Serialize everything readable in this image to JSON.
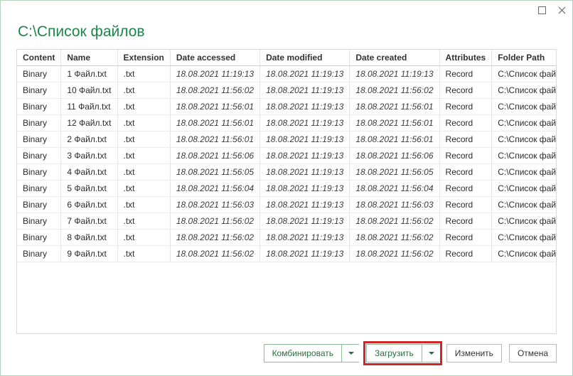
{
  "heading": "C:\\Список файлов",
  "titlebar": {
    "maximize_name": "maximize-icon",
    "close_name": "close-icon"
  },
  "table": {
    "headers": {
      "content": "Content",
      "name": "Name",
      "extension": "Extension",
      "accessed": "Date accessed",
      "modified": "Date modified",
      "created": "Date created",
      "attributes": "Attributes",
      "path": "Folder Path"
    },
    "rows": [
      {
        "content": "Binary",
        "name": "1 Файл.txt",
        "extension": ".txt",
        "accessed": "18.08.2021 11:19:13",
        "modified": "18.08.2021 11:19:13",
        "created": "18.08.2021 11:19:13",
        "attributes": "Record",
        "path": "C:\\Список файлов\\"
      },
      {
        "content": "Binary",
        "name": "10 Файл.txt",
        "extension": ".txt",
        "accessed": "18.08.2021 11:56:02",
        "modified": "18.08.2021 11:19:13",
        "created": "18.08.2021 11:56:02",
        "attributes": "Record",
        "path": "C:\\Список файлов\\"
      },
      {
        "content": "Binary",
        "name": "11 Файл.txt",
        "extension": ".txt",
        "accessed": "18.08.2021 11:56:01",
        "modified": "18.08.2021 11:19:13",
        "created": "18.08.2021 11:56:01",
        "attributes": "Record",
        "path": "C:\\Список файлов\\"
      },
      {
        "content": "Binary",
        "name": "12 Файл.txt",
        "extension": ".txt",
        "accessed": "18.08.2021 11:56:01",
        "modified": "18.08.2021 11:19:13",
        "created": "18.08.2021 11:56:01",
        "attributes": "Record",
        "path": "C:\\Список файлов\\"
      },
      {
        "content": "Binary",
        "name": "2 Файл.txt",
        "extension": ".txt",
        "accessed": "18.08.2021 11:56:01",
        "modified": "18.08.2021 11:19:13",
        "created": "18.08.2021 11:56:01",
        "attributes": "Record",
        "path": "C:\\Список файлов\\"
      },
      {
        "content": "Binary",
        "name": "3 Файл.txt",
        "extension": ".txt",
        "accessed": "18.08.2021 11:56:06",
        "modified": "18.08.2021 11:19:13",
        "created": "18.08.2021 11:56:06",
        "attributes": "Record",
        "path": "C:\\Список файлов\\"
      },
      {
        "content": "Binary",
        "name": "4 Файл.txt",
        "extension": ".txt",
        "accessed": "18.08.2021 11:56:05",
        "modified": "18.08.2021 11:19:13",
        "created": "18.08.2021 11:56:05",
        "attributes": "Record",
        "path": "C:\\Список файлов\\"
      },
      {
        "content": "Binary",
        "name": "5 Файл.txt",
        "extension": ".txt",
        "accessed": "18.08.2021 11:56:04",
        "modified": "18.08.2021 11:19:13",
        "created": "18.08.2021 11:56:04",
        "attributes": "Record",
        "path": "C:\\Список файлов\\"
      },
      {
        "content": "Binary",
        "name": "6 Файл.txt",
        "extension": ".txt",
        "accessed": "18.08.2021 11:56:03",
        "modified": "18.08.2021 11:19:13",
        "created": "18.08.2021 11:56:03",
        "attributes": "Record",
        "path": "C:\\Список файлов\\"
      },
      {
        "content": "Binary",
        "name": "7 Файл.txt",
        "extension": ".txt",
        "accessed": "18.08.2021 11:56:02",
        "modified": "18.08.2021 11:19:13",
        "created": "18.08.2021 11:56:02",
        "attributes": "Record",
        "path": "C:\\Список файлов\\"
      },
      {
        "content": "Binary",
        "name": "8 Файл.txt",
        "extension": ".txt",
        "accessed": "18.08.2021 11:56:02",
        "modified": "18.08.2021 11:19:13",
        "created": "18.08.2021 11:56:02",
        "attributes": "Record",
        "path": "C:\\Список файлов\\"
      },
      {
        "content": "Binary",
        "name": "9 Файл.txt",
        "extension": ".txt",
        "accessed": "18.08.2021 11:56:02",
        "modified": "18.08.2021 11:19:13",
        "created": "18.08.2021 11:56:02",
        "attributes": "Record",
        "path": "C:\\Список файлов\\"
      }
    ]
  },
  "footer": {
    "combine": "Комбинировать",
    "load": "Загрузить",
    "edit": "Изменить",
    "cancel": "Отмена"
  }
}
